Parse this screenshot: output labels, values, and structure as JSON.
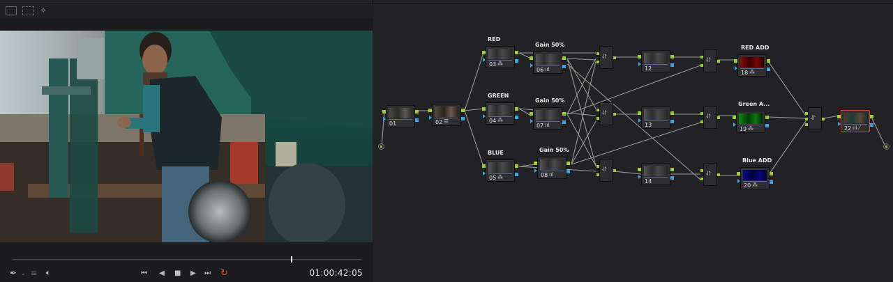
{
  "viewer": {
    "timecode": "01:00:42:05",
    "transport": {
      "first": "⏮",
      "prev": "◀",
      "stop": "■",
      "play": "▶",
      "last": "⏭",
      "loop": "↻"
    },
    "icons": [
      "viewer-layout-icon",
      "viewer-grid-icon",
      "magic-wand-icon",
      "color-picker-icon",
      "layers-icon",
      "speaker-icon"
    ]
  },
  "nodes": [
    {
      "id": "01",
      "label": ""
    },
    {
      "id": "02",
      "label": ""
    },
    {
      "id": "03",
      "label": "RED"
    },
    {
      "id": "04",
      "label": "GREEN"
    },
    {
      "id": "05",
      "label": "BLUE"
    },
    {
      "id": "06",
      "label": "Gain 50%"
    },
    {
      "id": "07",
      "label": "Gain 50%"
    },
    {
      "id": "08",
      "label": "Gain 50%"
    },
    {
      "id": "12",
      "label": ""
    },
    {
      "id": "13",
      "label": ""
    },
    {
      "id": "14",
      "label": ""
    },
    {
      "id": "18",
      "label": "RED ADD"
    },
    {
      "id": "19",
      "label": "Green A..."
    },
    {
      "id": "20",
      "label": "Blue ADD"
    },
    {
      "id": "22",
      "label": ""
    }
  ],
  "colors": {
    "accent_green": "#9ccf2e",
    "key_blue": "#3aa6e8",
    "selected_red": "#d8443a",
    "loop_red": "#e0453a"
  }
}
